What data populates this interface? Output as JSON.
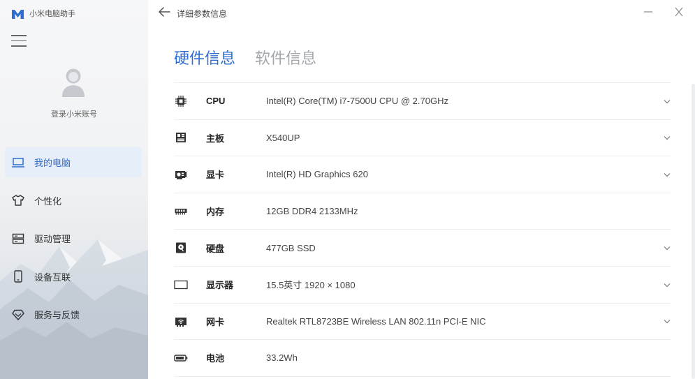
{
  "app": {
    "name": "小米电脑助手",
    "brand_color": "#2f6dd0"
  },
  "sidebar": {
    "login_label": "登录小米账号",
    "items": [
      {
        "label": "我的电脑",
        "icon": "laptop-icon",
        "active": true
      },
      {
        "label": "个性化",
        "icon": "tshirt-icon",
        "active": false
      },
      {
        "label": "驱动管理",
        "icon": "drivers-icon",
        "active": false
      },
      {
        "label": "设备互联",
        "icon": "phone-icon",
        "active": false
      },
      {
        "label": "服务与反馈",
        "icon": "diamond-icon",
        "active": false
      }
    ]
  },
  "header": {
    "title": "详细参数信息"
  },
  "tabs": [
    {
      "label": "硬件信息",
      "active": true
    },
    {
      "label": "软件信息",
      "active": false
    }
  ],
  "hardware": [
    {
      "label": "CPU",
      "value": "Intel(R) Core(TM) i7-7500U CPU @ 2.70GHz",
      "icon": "cpu-icon",
      "expandable": true
    },
    {
      "label": "主板",
      "value": "X540UP",
      "icon": "motherboard-icon",
      "expandable": true
    },
    {
      "label": "显卡",
      "value": "Intel(R) HD Graphics 620",
      "icon": "graphics-card-icon",
      "expandable": true
    },
    {
      "label": "内存",
      "value": "12GB DDR4 2133MHz",
      "icon": "memory-icon",
      "expandable": false
    },
    {
      "label": "硬盘",
      "value": "477GB SSD",
      "icon": "disk-icon",
      "expandable": true
    },
    {
      "label": "显示器",
      "value": "15.5英寸 1920 × 1080",
      "icon": "monitor-icon",
      "expandable": true
    },
    {
      "label": "网卡",
      "value": "Realtek RTL8723BE Wireless LAN 802.11n PCI-E NIC",
      "icon": "network-card-icon",
      "expandable": true
    },
    {
      "label": "电池",
      "value": "33.2Wh",
      "icon": "battery-icon",
      "expandable": false
    }
  ]
}
